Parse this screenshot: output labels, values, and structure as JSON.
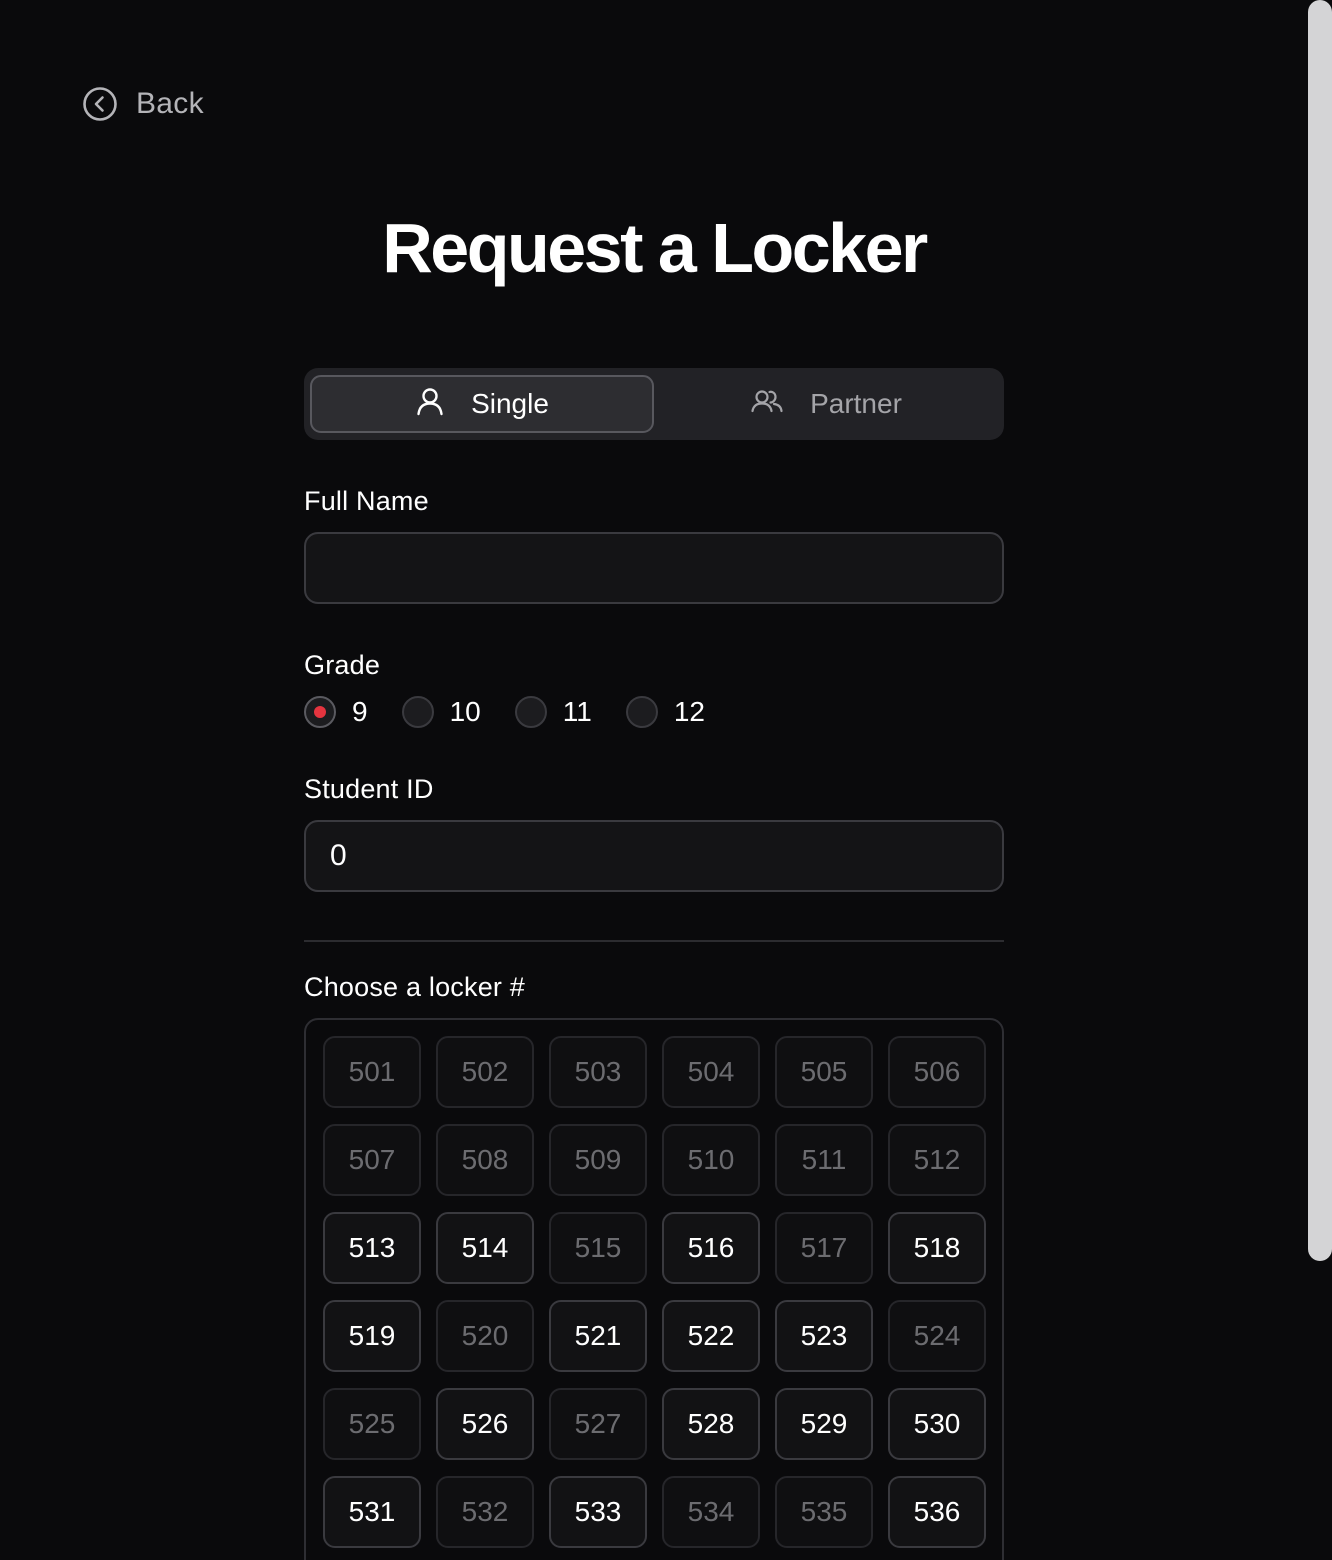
{
  "nav": {
    "back_label": "Back"
  },
  "page_title": "Request a Locker",
  "segment": {
    "single_label": "Single",
    "partner_label": "Partner",
    "selected": "Single"
  },
  "form": {
    "full_name": {
      "label": "Full Name",
      "value": "",
      "placeholder": ""
    },
    "grade": {
      "label": "Grade",
      "options": [
        "9",
        "10",
        "11",
        "12"
      ],
      "selected": "9"
    },
    "student_id": {
      "label": "Student ID",
      "value": "0"
    }
  },
  "locker_section": {
    "label": "Choose a locker #",
    "lockers": [
      {
        "number": "501",
        "available": false
      },
      {
        "number": "502",
        "available": false
      },
      {
        "number": "503",
        "available": false
      },
      {
        "number": "504",
        "available": false
      },
      {
        "number": "505",
        "available": false
      },
      {
        "number": "506",
        "available": false
      },
      {
        "number": "507",
        "available": false
      },
      {
        "number": "508",
        "available": false
      },
      {
        "number": "509",
        "available": false
      },
      {
        "number": "510",
        "available": false
      },
      {
        "number": "511",
        "available": false
      },
      {
        "number": "512",
        "available": false
      },
      {
        "number": "513",
        "available": true
      },
      {
        "number": "514",
        "available": true
      },
      {
        "number": "515",
        "available": false
      },
      {
        "number": "516",
        "available": true
      },
      {
        "number": "517",
        "available": false
      },
      {
        "number": "518",
        "available": true
      },
      {
        "number": "519",
        "available": true
      },
      {
        "number": "520",
        "available": false
      },
      {
        "number": "521",
        "available": true
      },
      {
        "number": "522",
        "available": true
      },
      {
        "number": "523",
        "available": true
      },
      {
        "number": "524",
        "available": false
      },
      {
        "number": "525",
        "available": false
      },
      {
        "number": "526",
        "available": true
      },
      {
        "number": "527",
        "available": false
      },
      {
        "number": "528",
        "available": true
      },
      {
        "number": "529",
        "available": true
      },
      {
        "number": "530",
        "available": true
      },
      {
        "number": "531",
        "available": true
      },
      {
        "number": "532",
        "available": false
      },
      {
        "number": "533",
        "available": true
      },
      {
        "number": "534",
        "available": false
      },
      {
        "number": "535",
        "available": false
      },
      {
        "number": "536",
        "available": true
      }
    ]
  },
  "colors": {
    "background": "#0a0a0c",
    "accent_radio": "#e5343f",
    "text_primary": "#ffffff",
    "text_muted": "#6c6c70"
  },
  "icons": {
    "back": "circle-chevron-left-icon",
    "single": "user-icon",
    "partner": "users-icon"
  }
}
